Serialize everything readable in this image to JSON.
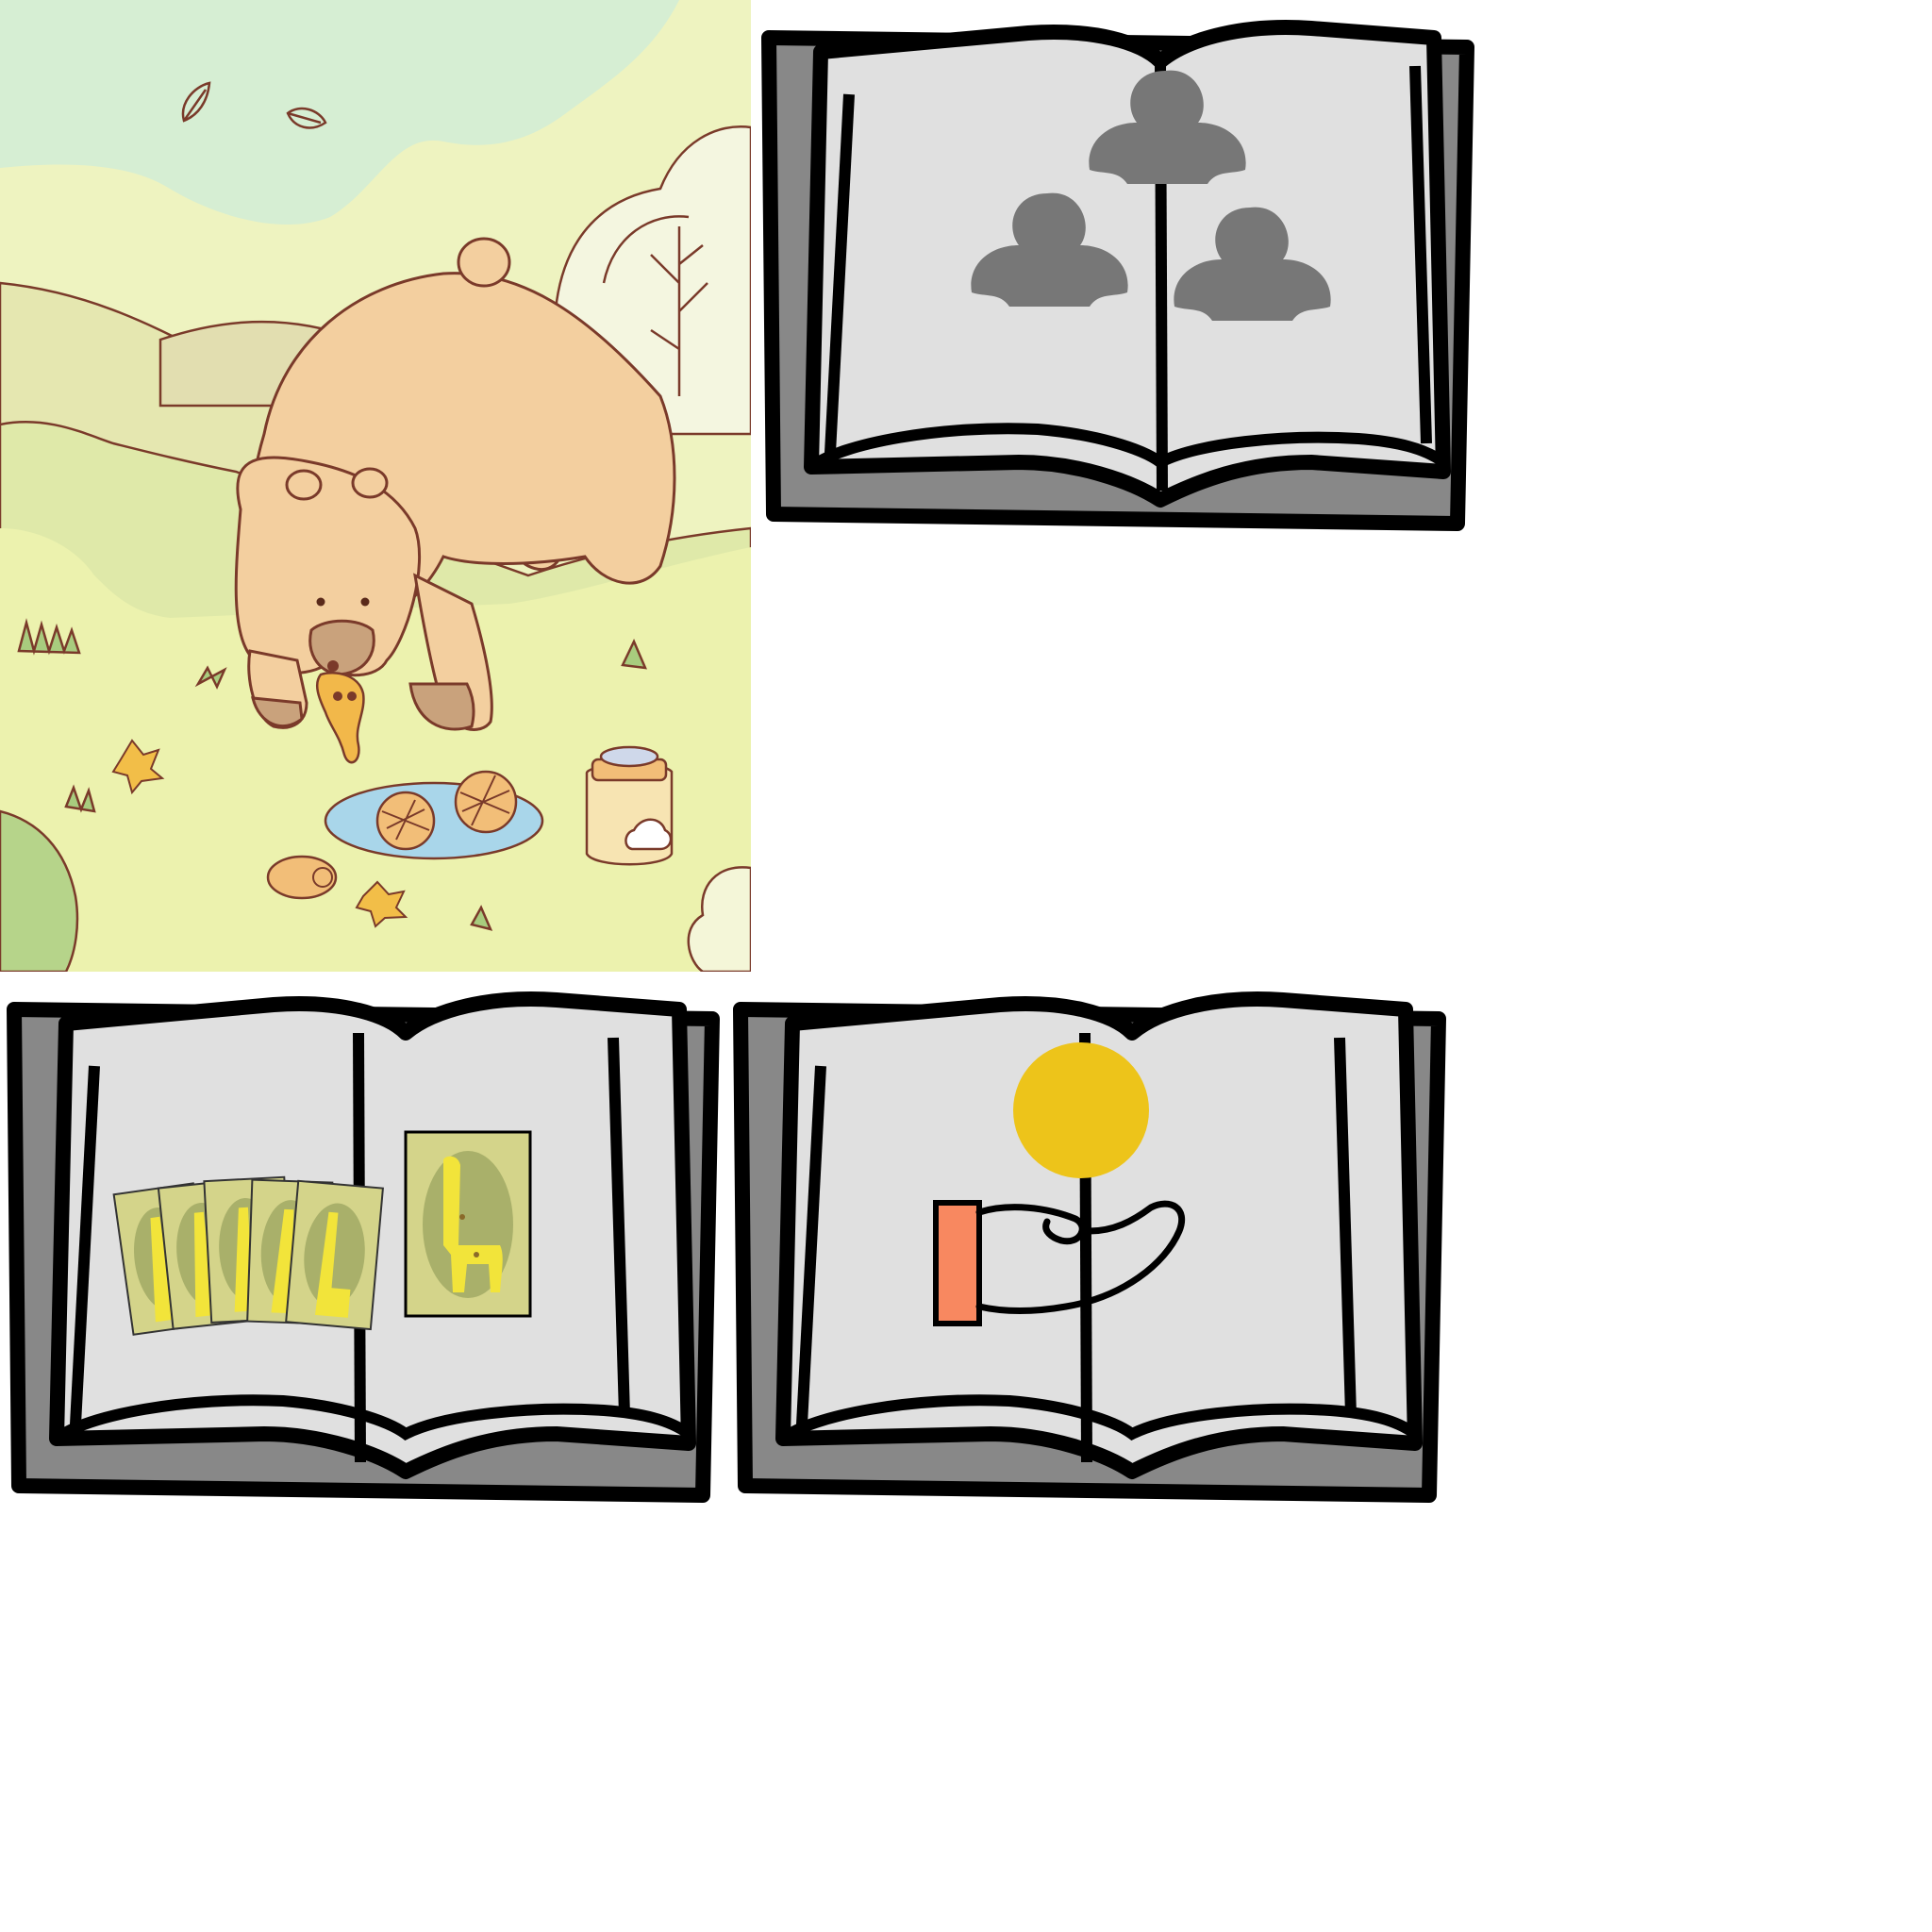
{
  "layout": "image-grid",
  "panels": [
    {
      "id": "scene",
      "icon": "bear-picnic-illustration"
    },
    {
      "id": "book-players",
      "icon": "open-book-icon",
      "content_icon": "player-pawns-icon",
      "count": 3
    },
    {
      "id": "book-cards",
      "icon": "open-book-icon",
      "content_icon": "giraffe-cards-icon",
      "count": 6
    },
    {
      "id": "book-coin",
      "icon": "open-book-icon",
      "content_icon": "hand-receiving-coin-icon"
    }
  ],
  "colors": {
    "sky": "#d6eed3",
    "meadow": "#eef2b0",
    "bear": "#f3cf9f",
    "book_page": "#e0e0e0",
    "book_cover": "#888888",
    "pawn": "#777777",
    "card": "#d4d48a",
    "giraffe": "#f2e43a",
    "coin": "#edc41a",
    "sleeve": "#f88860"
  }
}
